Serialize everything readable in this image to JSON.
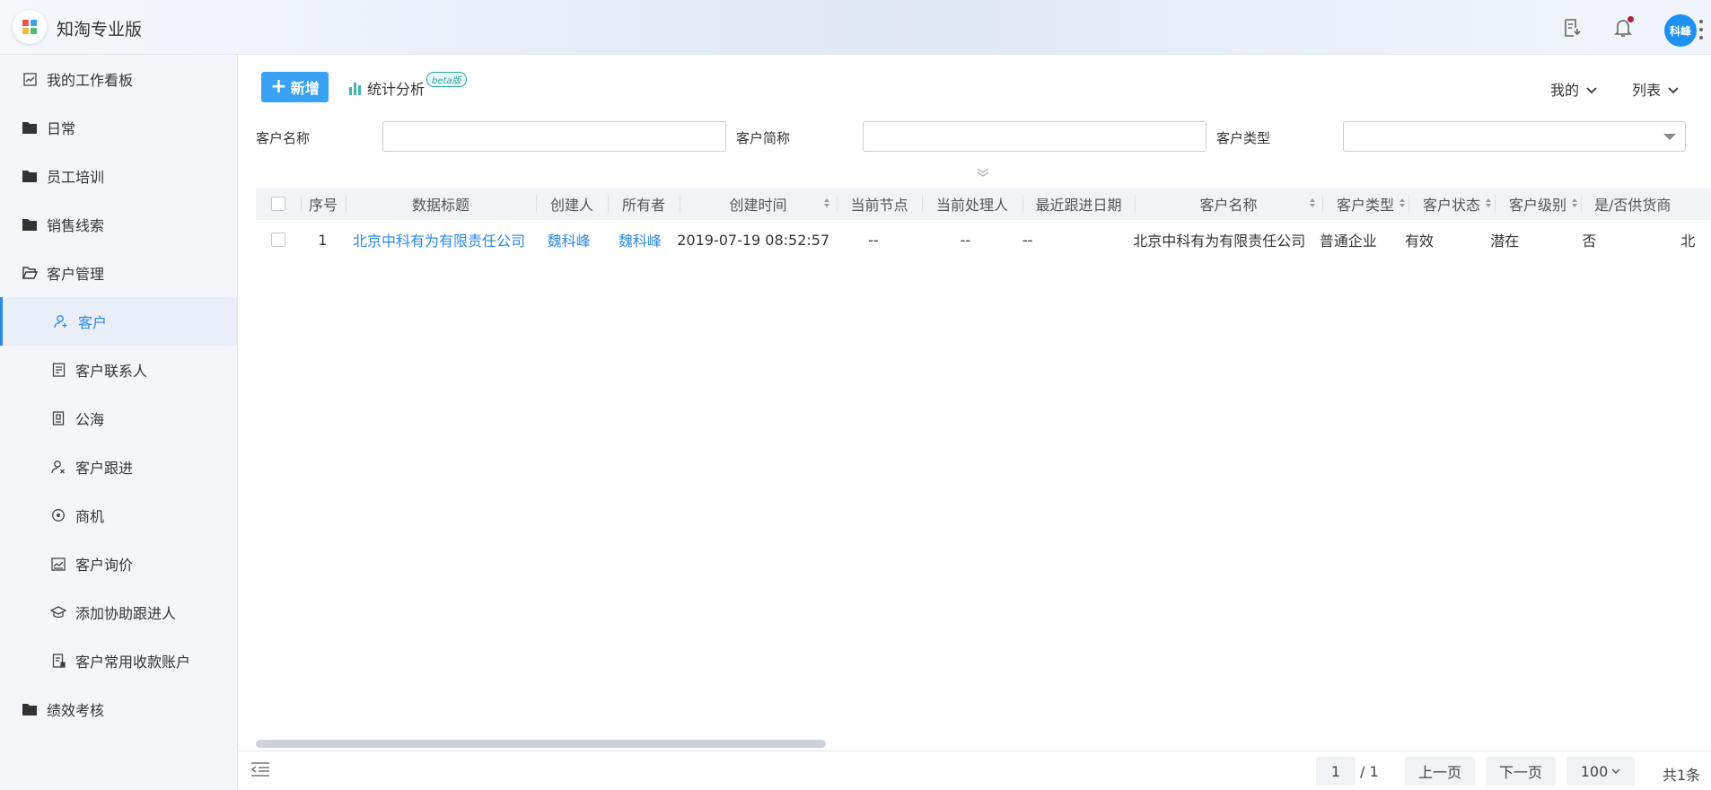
{
  "app": {
    "title": "知淘专业版"
  },
  "header": {
    "avatar_text": "科峰",
    "icons": [
      "export-icon",
      "bell-icon",
      "more-icon"
    ]
  },
  "sidebar": {
    "items": [
      {
        "label": "我的工作看板",
        "icon": "dashboard-icon",
        "level": 1
      },
      {
        "label": "日常",
        "icon": "folder-icon",
        "level": 1
      },
      {
        "label": "员工培训",
        "icon": "folder-icon",
        "level": 1
      },
      {
        "label": "销售线索",
        "icon": "folder-icon",
        "level": 1
      },
      {
        "label": "客户管理",
        "icon": "folder-open-icon",
        "level": 1
      },
      {
        "label": "客户",
        "icon": "user-add-icon",
        "level": 2,
        "active": true
      },
      {
        "label": "客户联系人",
        "icon": "contact-card-icon",
        "level": 2
      },
      {
        "label": "公海",
        "icon": "document-icon",
        "level": 2
      },
      {
        "label": "客户跟进",
        "icon": "user-follow-icon",
        "level": 2
      },
      {
        "label": "商机",
        "icon": "target-icon",
        "level": 2
      },
      {
        "label": "客户询价",
        "icon": "chart-icon",
        "level": 2
      },
      {
        "label": "添加协助跟进人",
        "icon": "graduation-icon",
        "level": 2
      },
      {
        "label": "客户常用收款账户",
        "icon": "account-icon",
        "level": 2
      },
      {
        "label": "绩效考核",
        "icon": "folder-icon",
        "level": 1
      }
    ]
  },
  "toolbar": {
    "new_label": "新增",
    "stats_label": "统计分析",
    "beta_label": "beta版",
    "scope_label": "我的",
    "view_label": "列表"
  },
  "filters": {
    "customer_name_label": "客户名称",
    "customer_short_label": "客户简称",
    "customer_type_label": "客户类型",
    "customer_name_value": "",
    "customer_short_value": "",
    "customer_type_value": ""
  },
  "table": {
    "columns": [
      "序号",
      "数据标题",
      "创建人",
      "所有者",
      "创建时间",
      "当前节点",
      "当前处理人",
      "最近跟进日期",
      "客户名称",
      "客户类型",
      "客户状态",
      "客户级别",
      "是/否供货商"
    ],
    "rows": [
      {
        "index": "1",
        "title": "北京中科有为有限责任公司",
        "creator": "魏科峰",
        "owner": "魏科峰",
        "created_at": "2019-07-19 08:52:57",
        "node": "--",
        "handler": "--",
        "last_follow": "--",
        "customer_name": "北京中科有为有限责任公司",
        "customer_type": "普通企业",
        "customer_status": "有效",
        "customer_level": "潜在",
        "is_supplier": "否",
        "overflow": "北"
      }
    ]
  },
  "pager": {
    "current_page": "1",
    "total_pages": "/ 1",
    "prev_label": "上一页",
    "next_label": "下一页",
    "page_size": "100",
    "total_label": "共1条"
  },
  "colors": {
    "accent": "#2b8ae6",
    "new_button": "#3aa2f2",
    "notif_dot": "#b0203a"
  }
}
